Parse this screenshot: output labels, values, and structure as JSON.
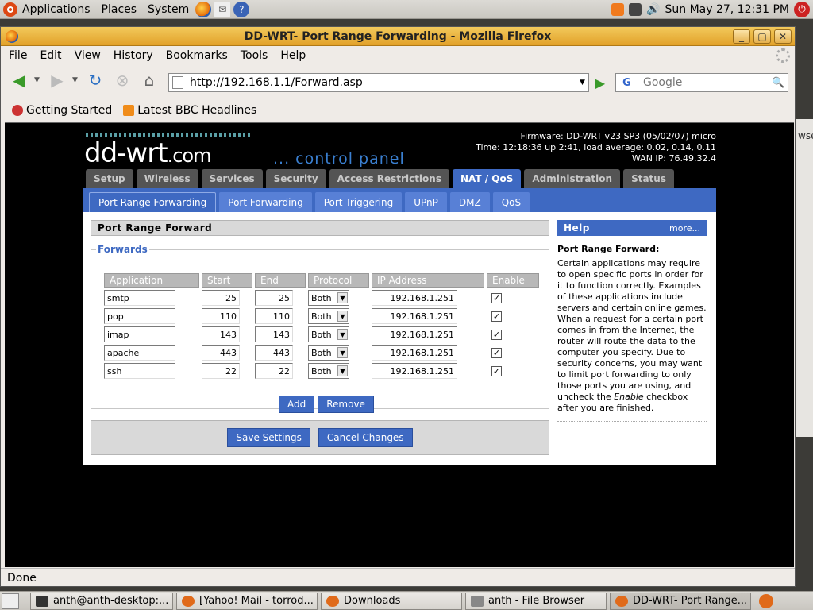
{
  "top_panel": {
    "menus": [
      "Applications",
      "Places",
      "System"
    ],
    "clock": "Sun May 27, 12:31 PM"
  },
  "window": {
    "title": "DD-WRT- Port Range Forwarding - Mozilla Firefox",
    "min": "_",
    "max": "▢",
    "close": "✕"
  },
  "menubar": [
    "File",
    "Edit",
    "View",
    "History",
    "Bookmarks",
    "Tools",
    "Help"
  ],
  "navbar": {
    "url": "http://192.168.1.1/Forward.asp",
    "search_placeholder": "Google",
    "search_engine": "G"
  },
  "bookmarks": [
    "Getting Started",
    "Latest BBC Headlines"
  ],
  "status": "Done",
  "ddwrt": {
    "logo": "dd-wrt",
    "logo_suffix": ".com",
    "control_panel": "... control panel",
    "firmware": "Firmware: DD-WRT v23 SP3 (05/02/07) micro",
    "time": "Time: 12:18:36 up 2:41, load average: 0.02, 0.14, 0.11",
    "wan_ip": "WAN IP: 76.49.32.4",
    "tabs": [
      "Setup",
      "Wireless",
      "Services",
      "Security",
      "Access Restrictions",
      "NAT / QoS",
      "Administration",
      "Status"
    ],
    "active_tab": "NAT / QoS",
    "subtabs": [
      "Port Range Forwarding",
      "Port Forwarding",
      "Port Triggering",
      "UPnP",
      "DMZ",
      "QoS"
    ],
    "section_title": "Port Range Forward",
    "legend": "Forwards",
    "columns": [
      "Application",
      "Start",
      "End",
      "Protocol",
      "IP Address",
      "Enable"
    ],
    "rows": [
      {
        "app": "smtp",
        "start": "25",
        "end": "25",
        "protocol": "Both",
        "ip": "192.168.1.251",
        "enabled": true
      },
      {
        "app": "pop",
        "start": "110",
        "end": "110",
        "protocol": "Both",
        "ip": "192.168.1.251",
        "enabled": true
      },
      {
        "app": "imap",
        "start": "143",
        "end": "143",
        "protocol": "Both",
        "ip": "192.168.1.251",
        "enabled": true
      },
      {
        "app": "apache",
        "start": "443",
        "end": "443",
        "protocol": "Both",
        "ip": "192.168.1.251",
        "enabled": true
      },
      {
        "app": "ssh",
        "start": "22",
        "end": "22",
        "protocol": "Both",
        "ip": "192.168.1.251",
        "enabled": true
      }
    ],
    "add_label": "Add",
    "remove_label": "Remove",
    "save_label": "Save Settings",
    "cancel_label": "Cancel Changes",
    "help": {
      "header": "Help",
      "more": "more...",
      "title": "Port Range Forward:",
      "text_before": "Certain applications may require to open specific ports in order for it to function correctly. Examples of these applications include servers and certain online games. When a request for a certain port comes in from the Internet, the router will route the data to the computer you specify. Due to security concerns, you may want to limit port forwarding to only those ports you are using, and uncheck the ",
      "text_em": "Enable",
      "text_after": " checkbox after you are finished."
    }
  },
  "desktop_strip": {
    "text1": "wse"
  },
  "taskbar": [
    {
      "label": "anth@anth-desktop:...",
      "color": "#333333"
    },
    {
      "label": "[Yahoo! Mail - torrod...",
      "color": "#e06a1a"
    },
    {
      "label": "Downloads",
      "color": "#e06a1a"
    },
    {
      "label": "anth - File Browser",
      "color": "#888888"
    },
    {
      "label": "DD-WRT- Port Range...",
      "color": "#e06a1a"
    }
  ],
  "colors": {
    "ddwrt_blue": "#3e69c2",
    "panel_gray": "#d9d9d9",
    "firefox_title": "#e2a12a"
  }
}
